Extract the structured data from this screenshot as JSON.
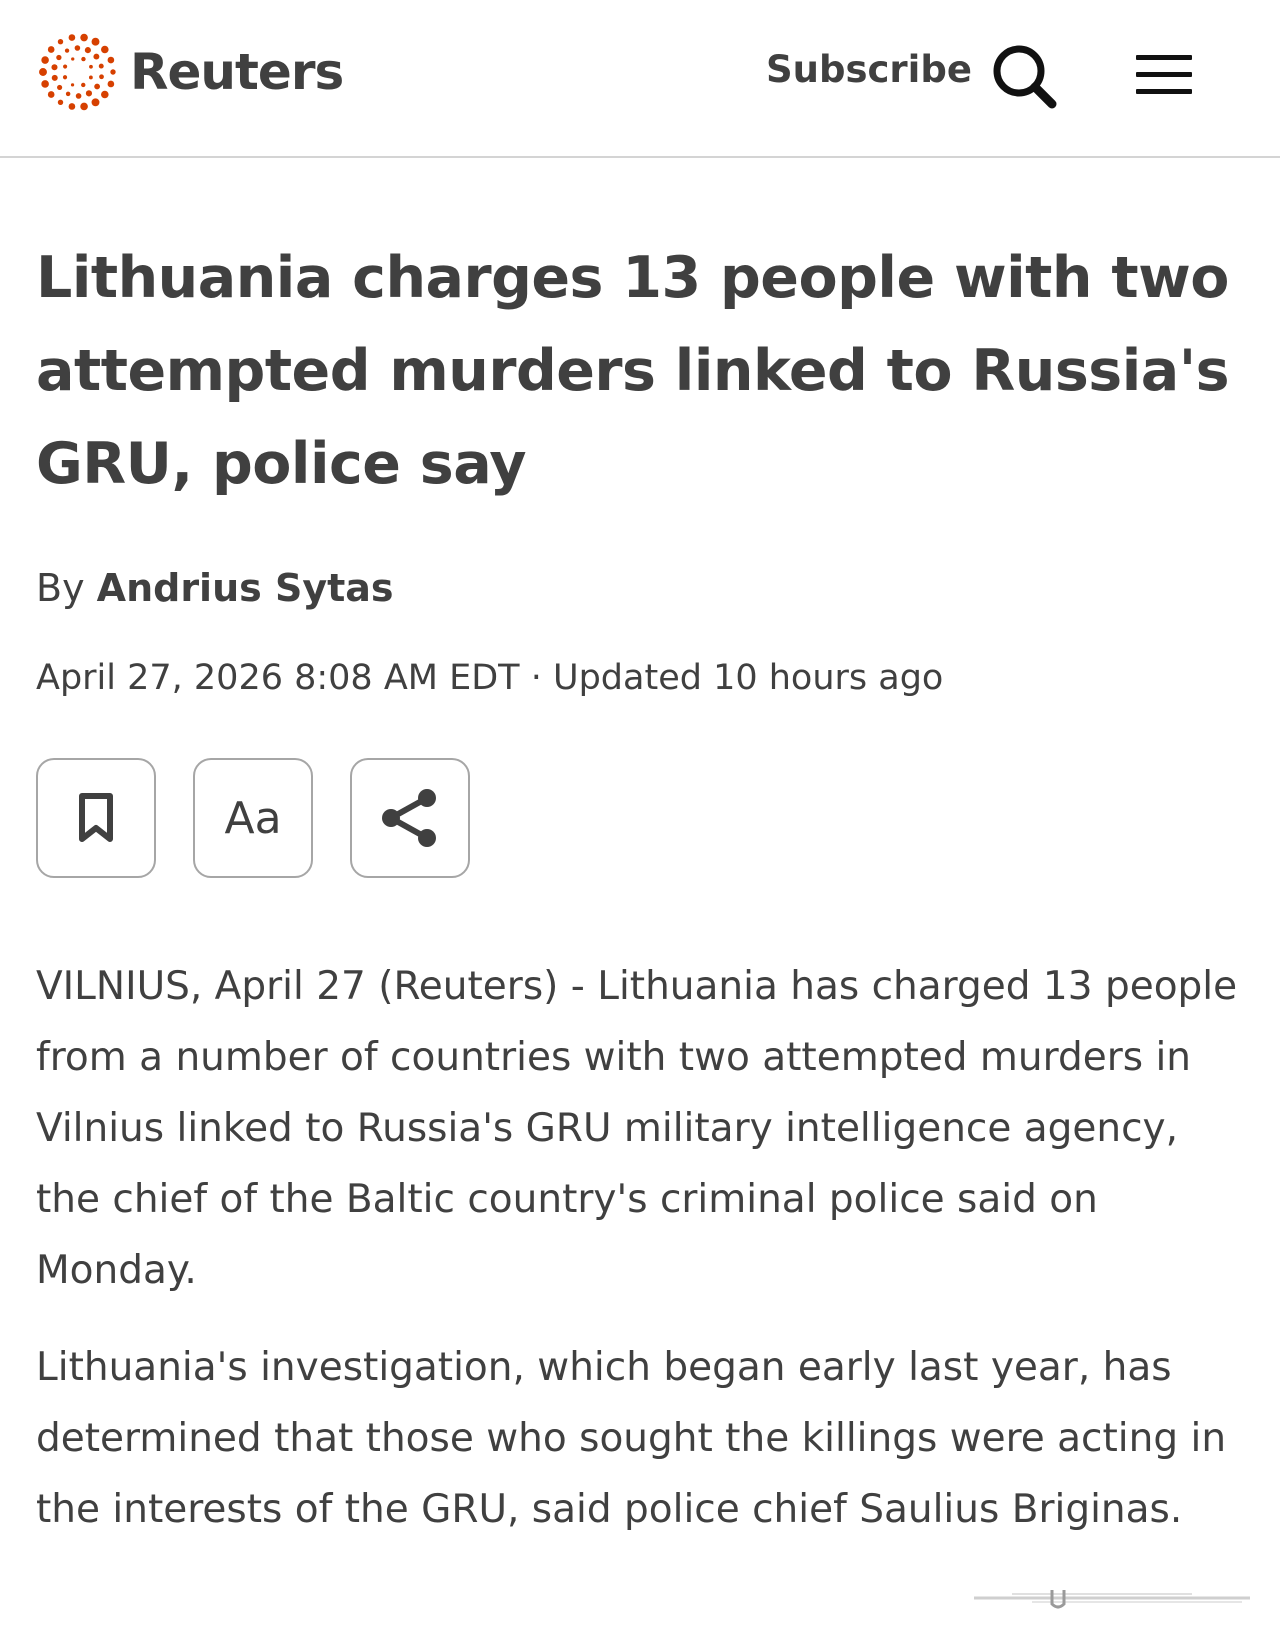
{
  "header": {
    "logo_text": "Reuters",
    "subscribe_label": "Subscribe",
    "search_icon": "search-icon",
    "menu_icon": "hamburger-menu-icon",
    "brand_color": "#D64000"
  },
  "article": {
    "headline": "Lithuania charges 13 people with two attempted murders linked to Russia's GRU, police say",
    "byline_prefix": "By",
    "author": "Andrius Sytas",
    "date": "April 27, 2026 8:08 AM EDT",
    "separator": "·",
    "updated": "Updated 10 hours ago",
    "actions": {
      "bookmark_icon": "bookmark-icon",
      "text_size_label": "Aa",
      "share_icon": "share-icon"
    },
    "paragraphs": [
      "VILNIUS, April 27 (Reuters) - Lithuania has charged 13 people from a number of countries with two attempted murders in Vilnius linked to Russia's GRU military intelligence agency, the chief of the Baltic country's criminal police said on Monday.",
      "Lithuania's investigation, which began early last year, has determined that those who sought the killings were acting in the interests of the GRU, said police chief Saulius Briginas."
    ]
  }
}
